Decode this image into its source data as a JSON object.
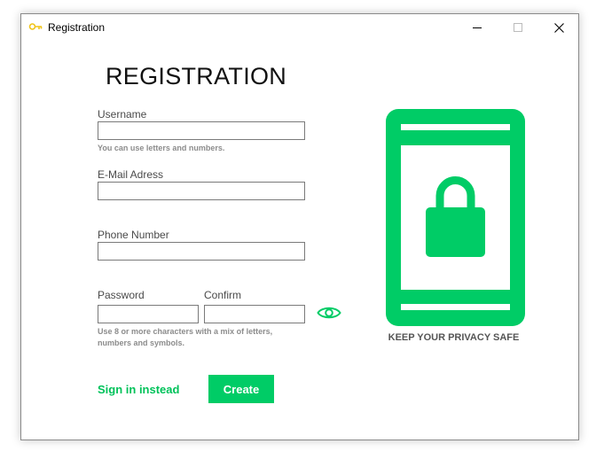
{
  "window": {
    "title": "Registration"
  },
  "form": {
    "heading": "REGISTRATION",
    "username": {
      "label": "Username",
      "value": "",
      "hint": "You can use letters and numbers."
    },
    "email": {
      "label": "E-Mail Adress",
      "value": ""
    },
    "phone": {
      "label": "Phone Number",
      "value": ""
    },
    "password": {
      "label": "Password",
      "value": ""
    },
    "confirm": {
      "label": "Confirm",
      "value": ""
    },
    "password_hint_line1": "Use 8 or more characters with a mix of letters,",
    "password_hint_line2": "numbers and symbols.",
    "signin_label": "Sign in instead",
    "create_label": "Create"
  },
  "illustration": {
    "caption": "KEEP YOUR PRIVACY SAFE"
  },
  "colors": {
    "accent": "#00cc66",
    "key_icon": "#f0c419"
  },
  "icons": [
    "key-icon",
    "minimize-icon",
    "maximize-icon",
    "close-icon",
    "eye-icon",
    "phone-lock-icon"
  ]
}
